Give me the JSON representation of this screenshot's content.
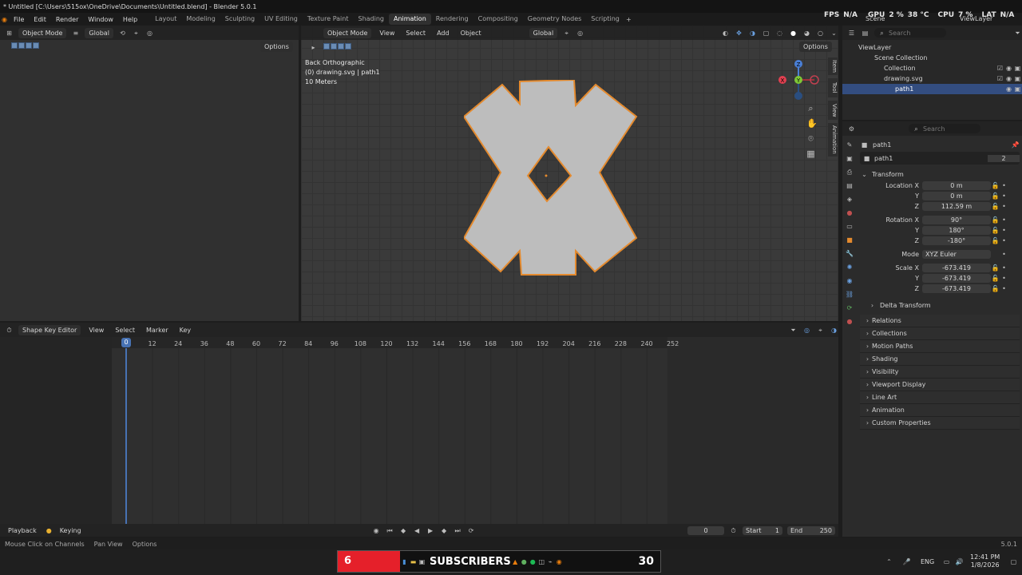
{
  "window": {
    "title": "* Untitled [C:\\Users\\515ox\\OneDrive\\Documents\\Untitled.blend] - Blender 5.0.1"
  },
  "menu": [
    "File",
    "Edit",
    "Render",
    "Window",
    "Help"
  ],
  "workspaces": [
    "Layout",
    "Modeling",
    "Sculpting",
    "UV Editing",
    "Texture Paint",
    "Shading",
    "Animation",
    "Rendering",
    "Compositing",
    "Geometry Nodes",
    "Scripting"
  ],
  "active_workspace": "Animation",
  "hud": {
    "fps_label": "FPS",
    "fps_val": "N/A",
    "gpu_label": "GPU",
    "gpu_val": "2 %",
    "gpu_temp": "38 °C",
    "cpu_label": "CPU",
    "cpu_val": "7 %",
    "lat_label": "LAT",
    "lat_val": "N/A",
    "scene": "Scene",
    "view_layer": "ViewLayer"
  },
  "left_view": {
    "mode": "Object Mode",
    "orientation": "Global",
    "options": "Options"
  },
  "viewport": {
    "mode": "Object Mode",
    "menus": [
      "View",
      "Select",
      "Add",
      "Object"
    ],
    "orientation": "Global",
    "options": "Options",
    "view_name": "Back Orthographic",
    "object_info": "(0) drawing.svg | path1",
    "scale": "10 Meters",
    "side_tabs": [
      "Item",
      "Tool",
      "View",
      "Animation"
    ]
  },
  "outliner": {
    "search_placeholder": "Search",
    "items": [
      {
        "label": "ViewLayer"
      },
      {
        "label": "Scene Collection"
      },
      {
        "label": "Collection"
      },
      {
        "label": "drawing.svg"
      },
      {
        "label": "path1"
      }
    ]
  },
  "properties": {
    "search_placeholder": "Search",
    "object_name": "path1",
    "data_name": "path1",
    "users": "2",
    "transform_label": "Transform",
    "location": {
      "label": "Location X",
      "x": "0 m",
      "y": "0 m",
      "z": "112.59 m"
    },
    "rotation": {
      "label": "Rotation X",
      "x": "90°",
      "y": "180°",
      "z": "-180°"
    },
    "mode_label": "Mode",
    "mode_value": "XYZ Euler",
    "scale": {
      "label": "Scale X",
      "x": "-673.419",
      "y": "-673.419",
      "z": "-673.419"
    },
    "axis_y": "Y",
    "axis_z": "Z",
    "delta": "Delta Transform",
    "sections": [
      "Relations",
      "Collections",
      "Motion Paths",
      "Shading",
      "Visibility",
      "Viewport Display",
      "Line Art",
      "Animation",
      "Custom Properties"
    ]
  },
  "timeline_editor": {
    "editor": "Shape Key Editor",
    "menus": [
      "View",
      "Select",
      "Marker",
      "Key"
    ],
    "ticks": [
      "0",
      "12",
      "24",
      "36",
      "48",
      "60",
      "72",
      "84",
      "96",
      "108",
      "120",
      "132",
      "144",
      "156",
      "168",
      "180",
      "192",
      "204",
      "216",
      "228",
      "240",
      "252"
    ],
    "current_frame": "0"
  },
  "playback": {
    "playback": "Playback",
    "keying": "Keying",
    "frame": "0",
    "start_label": "Start",
    "start": "1",
    "end_label": "End",
    "end": "250"
  },
  "status": {
    "hint1": "Mouse Click on Channels",
    "hint2": "Pan View",
    "hint3": "Options",
    "version": "5.0.1"
  },
  "taskbar": {
    "counter_left": "6",
    "subscribers": "SUBSCRIBERS",
    "counter_right": "30",
    "lang": "ENG",
    "time": "12:41 PM",
    "date": "1/8/2026"
  },
  "colors": {
    "accent": "#4772b3",
    "selection": "#e48a2e",
    "shape_fill": "#bdbdbd",
    "counter_red": "#e5202a"
  }
}
